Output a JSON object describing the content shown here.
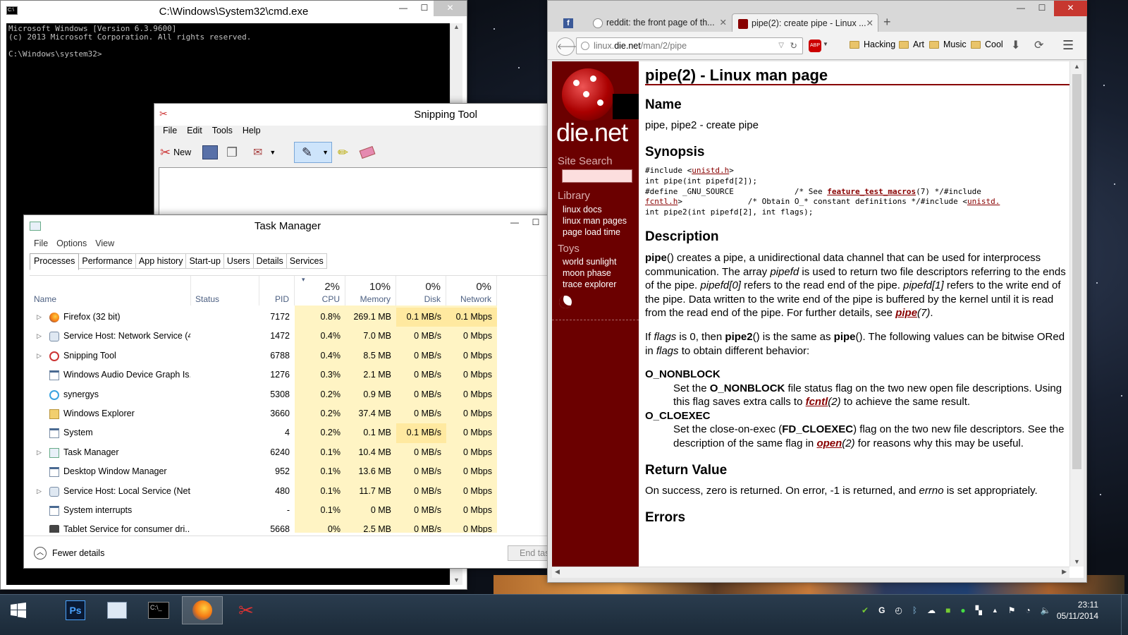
{
  "colors": {
    "cmd_bg": "#000000",
    "cmd_fg": "#c0c0c0",
    "dienet_sidebar": "#6b0000",
    "dienet_link": "#880000",
    "tm_heat": "#fff4c4",
    "taskbar": "#1b2a38"
  },
  "cmd": {
    "title": "C:\\Windows\\System32\\cmd.exe",
    "lines": [
      "Microsoft Windows [Version 6.3.9600]",
      "(c) 2013 Microsoft Corporation. All rights reserved.",
      "",
      "C:\\Windows\\system32>"
    ]
  },
  "snipping": {
    "title": "Snipping Tool",
    "menu": [
      "File",
      "Edit",
      "Tools",
      "Help"
    ],
    "new_label": "New"
  },
  "taskmgr": {
    "title": "Task Manager",
    "menu": [
      "File",
      "Options",
      "View"
    ],
    "tabs": [
      "Processes",
      "Performance",
      "App history",
      "Start-up",
      "Users",
      "Details",
      "Services"
    ],
    "headers": {
      "name": "Name",
      "status": "Status",
      "pid": "PID",
      "cpu_pct": "2%",
      "cpu": "CPU",
      "mem_pct": "10%",
      "mem": "Memory",
      "disk_pct": "0%",
      "disk": "Disk",
      "net_pct": "0%",
      "net": "Network"
    },
    "rows": [
      {
        "name": "Firefox (32 bit)",
        "pid": "7172",
        "cpu": "0.8%",
        "mem": "269.1 MB",
        "disk": "0.1 MB/s",
        "net": "0.1 Mbps",
        "icon": "firefox-icon",
        "expand": true
      },
      {
        "name": "Service Host: Network Service (4)",
        "pid": "1472",
        "cpu": "0.4%",
        "mem": "7.0 MB",
        "disk": "0 MB/s",
        "net": "0 Mbps",
        "icon": "gear-icon",
        "expand": true
      },
      {
        "name": "Snipping Tool",
        "pid": "6788",
        "cpu": "0.4%",
        "mem": "8.5 MB",
        "disk": "0 MB/s",
        "net": "0 Mbps",
        "icon": "scissors-icon",
        "expand": true
      },
      {
        "name": "Windows Audio Device Graph Is...",
        "pid": "1276",
        "cpu": "0.3%",
        "mem": "2.1 MB",
        "disk": "0 MB/s",
        "net": "0 Mbps",
        "icon": "window-icon",
        "expand": false
      },
      {
        "name": "synergys",
        "pid": "5308",
        "cpu": "0.2%",
        "mem": "0.9 MB",
        "disk": "0 MB/s",
        "net": "0 Mbps",
        "icon": "synergy-icon",
        "expand": false
      },
      {
        "name": "Windows Explorer",
        "pid": "3660",
        "cpu": "0.2%",
        "mem": "37.4 MB",
        "disk": "0 MB/s",
        "net": "0 Mbps",
        "icon": "folder-icon",
        "expand": false
      },
      {
        "name": "System",
        "pid": "4",
        "cpu": "0.2%",
        "mem": "0.1 MB",
        "disk": "0.1 MB/s",
        "net": "0 Mbps",
        "icon": "window-icon",
        "expand": false
      },
      {
        "name": "Task Manager",
        "pid": "6240",
        "cpu": "0.1%",
        "mem": "10.4 MB",
        "disk": "0 MB/s",
        "net": "0 Mbps",
        "icon": "taskmgr-icon",
        "expand": true
      },
      {
        "name": "Desktop Window Manager",
        "pid": "952",
        "cpu": "0.1%",
        "mem": "13.6 MB",
        "disk": "0 MB/s",
        "net": "0 Mbps",
        "icon": "window-icon",
        "expand": false
      },
      {
        "name": "Service Host: Local Service (Net...",
        "pid": "480",
        "cpu": "0.1%",
        "mem": "11.7 MB",
        "disk": "0 MB/s",
        "net": "0 Mbps",
        "icon": "gear-icon",
        "expand": true
      },
      {
        "name": "System interrupts",
        "pid": "-",
        "cpu": "0.1%",
        "mem": "0 MB",
        "disk": "0 MB/s",
        "net": "0 Mbps",
        "icon": "window-icon",
        "expand": false
      },
      {
        "name": "Tablet Service for consumer dri...",
        "pid": "5668",
        "cpu": "0%",
        "mem": "2.5 MB",
        "disk": "0 MB/s",
        "net": "0 Mbps",
        "icon": "pen-icon",
        "expand": false
      }
    ],
    "fewer_details": "Fewer details",
    "end_task": "End task"
  },
  "firefox": {
    "tabs": [
      {
        "label": ""
      },
      {
        "label": "reddit: the front page of th..."
      },
      {
        "label": "pipe(2): create pipe - Linux ..."
      }
    ],
    "url_host_pre": "linux.",
    "url_host": "die.net",
    "url_path": "/man/2/pipe",
    "bookmarks": [
      "Hacking",
      "Art",
      "Music",
      "Cool"
    ],
    "sidebar": {
      "brand": "die.net",
      "search_heading": "Site Search",
      "library_heading": "Library",
      "library_links": [
        "linux docs",
        "linux man pages",
        "page load time"
      ],
      "toys_heading": "Toys",
      "toys_links": [
        "world sunlight",
        "moon phase",
        "trace explorer"
      ]
    },
    "page": {
      "title": "pipe(2) - Linux man page",
      "h_name": "Name",
      "name_text": "pipe, pipe2 - create pipe",
      "h_synopsis": "Synopsis",
      "syn1": "#include <",
      "syn1_link": "unistd.h",
      "syn1_end": ">",
      "syn2": "int pipe(int pipefd[2]);",
      "syn3a": "#define _GNU_SOURCE             /* See ",
      "syn3_link": "feature_test_macros",
      "syn3b": "(7) */#include",
      "syn4_link": "fcntl.h",
      "syn4a": ">              /* Obtain O_* constant definitions */#include <",
      "syn4_link2": "unistd.",
      "syn5": "int pipe2(int pipefd[2], int flags);",
      "h_description": "Description",
      "d1_bold": "pipe",
      "d1": "() creates a pipe, a unidirectional data channel that can be used for interprocess communication. The array ",
      "d1_i1": "pipefd",
      "d1b": " is used to return two file descriptors referring to the ends of the pipe. ",
      "d1_i2": "pipefd[0]",
      "d1c": " refers to the read end of the pipe. ",
      "d1_i3": "pipefd[1]",
      "d1d": " refers to the write end of the pipe. Data written to the write end of the pipe is buffered by the kernel until it is read from the read end of the pipe. For further details, see ",
      "d1_link": "pipe",
      "d1_link_sfx": "(7)",
      "d1_end": ".",
      "d2a": "If ",
      "d2_i1": "flags",
      "d2b": " is 0, then ",
      "d2_b1": "pipe2",
      "d2c": "() is the same as ",
      "d2_b2": "pipe",
      "d2d": "(). The following values can be bitwise ORed in ",
      "d2_i2": "flags",
      "d2e": " to obtain different behavior:",
      "o_nonblock": "O_NONBLOCK",
      "o_nb_a": "Set the ",
      "o_nb_b": "O_NONBLOCK",
      "o_nb_c": " file status flag on the two new open file descriptions. Using this flag saves extra calls to ",
      "o_nb_link": "fcntl",
      "o_nb_sfx": "(2)",
      "o_nb_d": " to achieve the same result.",
      "o_cloexec": "O_CLOEXEC",
      "o_ce_a": "Set the close-on-exec (",
      "o_ce_b": "FD_CLOEXEC",
      "o_ce_c": ") flag on the two new file descriptors. See the description of the same flag in ",
      "o_ce_link": "open",
      "o_ce_sfx": "(2)",
      "o_ce_d": " for reasons why this may be useful.",
      "h_return": "Return Value",
      "ret_a": "On success, zero is returned. On error, -1 is returned, and ",
      "ret_i": "errno",
      "ret_b": " is set appropriately.",
      "h_errors": "Errors"
    }
  },
  "taskbar": {
    "apps": [
      "start-icon",
      "photoshop-icon",
      "explorer-icon",
      "cmd-icon",
      "firefox-icon",
      "snipping-icon"
    ],
    "ps_label": "Ps",
    "cmd_label": "C:\\_",
    "time": "23:11",
    "date": "05/11/2014"
  }
}
